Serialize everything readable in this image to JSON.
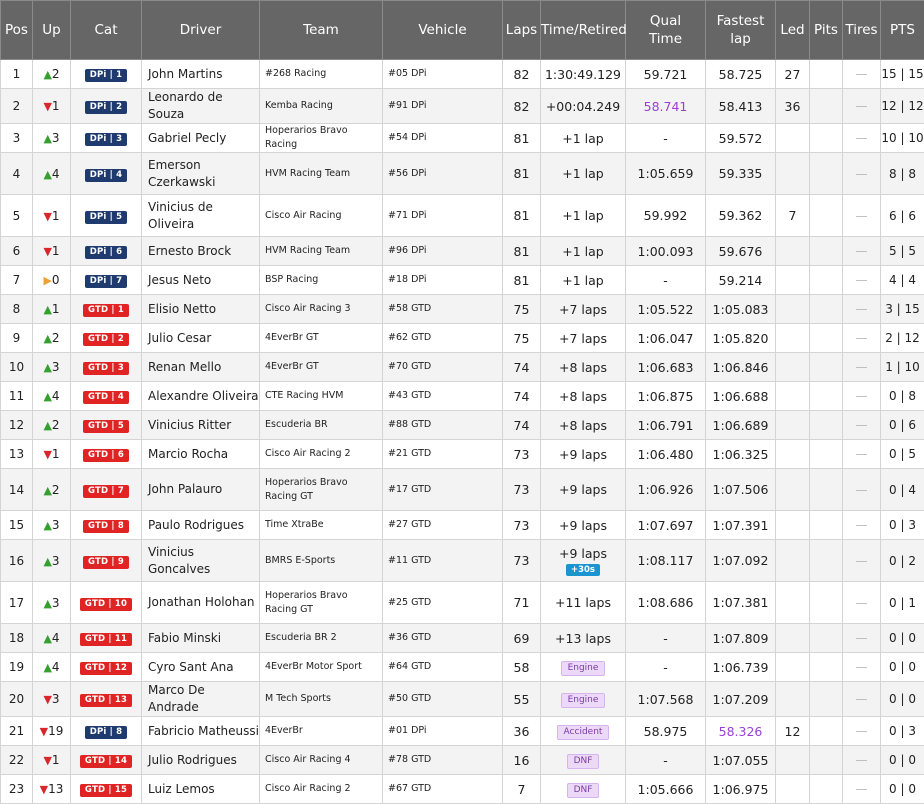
{
  "headers": {
    "pos": "Pos",
    "up": "Up",
    "cat": "Cat",
    "driver": "Driver",
    "team": "Team",
    "vehicle": "Vehicle",
    "laps": "Laps",
    "time": "Time/Retired",
    "qual": "Qual Time",
    "fastest": "Fastest lap",
    "led": "Led",
    "pits": "Pits",
    "tires": "Tires",
    "pts": "PTS"
  },
  "colors": {
    "header_bg": "#666666",
    "up": "#35a02f",
    "down": "#d9252c",
    "same": "#f0a030",
    "dpi": "#1e3a6e",
    "gtd": "#e02424",
    "purple": "#9b40d4",
    "penalty": "#1b95d2"
  },
  "rows": [
    {
      "pos": "1",
      "dir": "up",
      "up": "2",
      "cat": "DPi",
      "catpos": "DPi | 1",
      "driver": "John Martins",
      "team": "#268 Racing",
      "vehicle": "#05 DPi",
      "laps": "82",
      "time": "1:30:49.129",
      "qual": "59.721",
      "fastest": "58.725",
      "led": "27",
      "pits": "",
      "tires": "—",
      "pts": "15 | 15"
    },
    {
      "pos": "2",
      "dir": "down",
      "up": "1",
      "cat": "DPi",
      "catpos": "DPi | 2",
      "driver": "Leonardo de Souza",
      "team": "Kemba Racing",
      "vehicle": "#91 DPi",
      "laps": "82",
      "time": "+00:04.249",
      "qual": "58.741",
      "qual_best": true,
      "fastest": "58.413",
      "led": "36",
      "pits": "",
      "tires": "—",
      "pts": "12 | 12"
    },
    {
      "pos": "3",
      "dir": "up",
      "up": "3",
      "cat": "DPi",
      "catpos": "DPi | 3",
      "driver": "Gabriel Pecly",
      "team": "Hoperarios Bravo Racing",
      "vehicle": "#54 DPi",
      "laps": "81",
      "time": "+1 lap",
      "qual": "-",
      "fastest": "59.572",
      "led": "",
      "pits": "",
      "tires": "—",
      "pts": "10 | 10"
    },
    {
      "pos": "4",
      "dir": "up",
      "up": "4",
      "cat": "DPi",
      "catpos": "DPi | 4",
      "driver": "Emerson Czerkawski",
      "team": "HVM Racing Team",
      "vehicle": "#56 DPi",
      "laps": "81",
      "time": "+1 lap",
      "qual": "1:05.659",
      "fastest": "59.335",
      "led": "",
      "pits": "",
      "tires": "—",
      "pts": "8 | 8",
      "tall": true
    },
    {
      "pos": "5",
      "dir": "down",
      "up": "1",
      "cat": "DPi",
      "catpos": "DPi | 5",
      "driver": "Vinicius de Oliveira",
      "team": "Cisco Air Racing",
      "vehicle": "#71 DPi",
      "laps": "81",
      "time": "+1 lap",
      "qual": "59.992",
      "fastest": "59.362",
      "led": "7",
      "pits": "",
      "tires": "—",
      "pts": "6 | 6",
      "tall": true
    },
    {
      "pos": "6",
      "dir": "down",
      "up": "1",
      "cat": "DPi",
      "catpos": "DPi | 6",
      "driver": "Ernesto Brock",
      "team": "HVM Racing Team",
      "vehicle": "#96 DPi",
      "laps": "81",
      "time": "+1 lap",
      "qual": "1:00.093",
      "fastest": "59.676",
      "led": "",
      "pits": "",
      "tires": "—",
      "pts": "5 | 5"
    },
    {
      "pos": "7",
      "dir": "same",
      "up": "0",
      "cat": "DPi",
      "catpos": "DPi | 7",
      "driver": "Jesus Neto",
      "team": "BSP Racing",
      "vehicle": "#18 DPi",
      "laps": "81",
      "time": "+1 lap",
      "qual": "-",
      "fastest": "59.214",
      "led": "",
      "pits": "",
      "tires": "—",
      "pts": "4 | 4"
    },
    {
      "pos": "8",
      "dir": "up",
      "up": "1",
      "cat": "GTD",
      "catpos": "GTD | 1",
      "driver": "Elisio Netto",
      "team": "Cisco Air Racing 3",
      "vehicle": "#58 GTD",
      "laps": "75",
      "time": "+7 laps",
      "qual": "1:05.522",
      "fastest": "1:05.083",
      "led": "",
      "pits": "",
      "tires": "—",
      "pts": "3 | 15"
    },
    {
      "pos": "9",
      "dir": "up",
      "up": "2",
      "cat": "GTD",
      "catpos": "GTD | 2",
      "driver": "Julio Cesar",
      "team": "4EverBr GT",
      "vehicle": "#62 GTD",
      "laps": "75",
      "time": "+7 laps",
      "qual": "1:06.047",
      "fastest": "1:05.820",
      "led": "",
      "pits": "",
      "tires": "—",
      "pts": "2 | 12"
    },
    {
      "pos": "10",
      "dir": "up",
      "up": "3",
      "cat": "GTD",
      "catpos": "GTD | 3",
      "driver": "Renan Mello",
      "team": "4EverBr GT",
      "vehicle": "#70 GTD",
      "laps": "74",
      "time": "+8 laps",
      "qual": "1:06.683",
      "fastest": "1:06.846",
      "led": "",
      "pits": "",
      "tires": "—",
      "pts": "1 | 10"
    },
    {
      "pos": "11",
      "dir": "up",
      "up": "4",
      "cat": "GTD",
      "catpos": "GTD | 4",
      "driver": "Alexandre Oliveira",
      "team": "CTE Racing HVM",
      "vehicle": "#43 GTD",
      "laps": "74",
      "time": "+8 laps",
      "qual": "1:06.875",
      "fastest": "1:06.688",
      "led": "",
      "pits": "",
      "tires": "—",
      "pts": "0 | 8"
    },
    {
      "pos": "12",
      "dir": "up",
      "up": "2",
      "cat": "GTD",
      "catpos": "GTD | 5",
      "driver": "Vinicius Ritter",
      "team": "Escuderia BR",
      "vehicle": "#88 GTD",
      "laps": "74",
      "time": "+8 laps",
      "qual": "1:06.791",
      "fastest": "1:06.689",
      "led": "",
      "pits": "",
      "tires": "—",
      "pts": "0 | 6"
    },
    {
      "pos": "13",
      "dir": "down",
      "up": "1",
      "cat": "GTD",
      "catpos": "GTD | 6",
      "driver": "Marcio Rocha",
      "team": "Cisco Air Racing 2",
      "vehicle": "#21 GTD",
      "laps": "73",
      "time": "+9 laps",
      "qual": "1:06.480",
      "fastest": "1:06.325",
      "led": "",
      "pits": "",
      "tires": "—",
      "pts": "0 | 5"
    },
    {
      "pos": "14",
      "dir": "up",
      "up": "2",
      "cat": "GTD",
      "catpos": "GTD | 7",
      "driver": "John Palauro",
      "team": "Hoperarios Bravo Racing GT",
      "vehicle": "#17 GTD",
      "laps": "73",
      "time": "+9 laps",
      "qual": "1:06.926",
      "fastest": "1:07.506",
      "led": "",
      "pits": "",
      "tires": "—",
      "pts": "0 | 4",
      "tall": true
    },
    {
      "pos": "15",
      "dir": "up",
      "up": "3",
      "cat": "GTD",
      "catpos": "GTD | 8",
      "driver": "Paulo Rodrigues",
      "team": "Time XtraBe",
      "vehicle": "#27 GTD",
      "laps": "73",
      "time": "+9 laps",
      "qual": "1:07.697",
      "fastest": "1:07.391",
      "led": "",
      "pits": "",
      "tires": "—",
      "pts": "0 | 3"
    },
    {
      "pos": "16",
      "dir": "up",
      "up": "3",
      "cat": "GTD",
      "catpos": "GTD | 9",
      "driver": "Vinicius Goncalves",
      "team": "BMRS E-Sports",
      "vehicle": "#11 GTD",
      "laps": "73",
      "time": "+9 laps",
      "penalty": "+30s",
      "qual": "1:08.117",
      "fastest": "1:07.092",
      "led": "",
      "pits": "",
      "tires": "—",
      "pts": "0 | 2",
      "tall": true
    },
    {
      "pos": "17",
      "dir": "up",
      "up": "3",
      "cat": "GTD",
      "catpos": "GTD | 10",
      "driver": "Jonathan Holohan",
      "team": "Hoperarios Bravo Racing GT",
      "vehicle": "#25 GTD",
      "laps": "71",
      "time": "+11 laps",
      "qual": "1:08.686",
      "fastest": "1:07.381",
      "led": "",
      "pits": "",
      "tires": "—",
      "pts": "0 | 1",
      "tall": true
    },
    {
      "pos": "18",
      "dir": "up",
      "up": "4",
      "cat": "GTD",
      "catpos": "GTD | 11",
      "driver": "Fabio Minski",
      "team": "Escuderia BR 2",
      "vehicle": "#36 GTD",
      "laps": "69",
      "time": "+13 laps",
      "qual": "-",
      "fastest": "1:07.809",
      "led": "",
      "pits": "",
      "tires": "—",
      "pts": "0 | 0"
    },
    {
      "pos": "19",
      "dir": "up",
      "up": "4",
      "cat": "GTD",
      "catpos": "GTD | 12",
      "driver": "Cyro Sant Ana",
      "team": "4EverBr Motor Sport",
      "vehicle": "#64 GTD",
      "laps": "58",
      "pill": "Engine",
      "qual": "-",
      "fastest": "1:06.739",
      "led": "",
      "pits": "",
      "tires": "—",
      "pts": "0 | 0"
    },
    {
      "pos": "20",
      "dir": "down",
      "up": "3",
      "cat": "GTD",
      "catpos": "GTD | 13",
      "driver": "Marco De Andrade",
      "team": "M Tech Sports",
      "vehicle": "#50 GTD",
      "laps": "55",
      "pill": "Engine",
      "qual": "1:07.568",
      "fastest": "1:07.209",
      "led": "",
      "pits": "",
      "tires": "—",
      "pts": "0 | 0"
    },
    {
      "pos": "21",
      "dir": "down",
      "up": "19",
      "cat": "DPi",
      "catpos": "DPi | 8",
      "driver": "Fabricio Matheussi",
      "team": "4EverBr",
      "vehicle": "#01 DPi",
      "laps": "36",
      "pill": "Accident",
      "qual": "58.975",
      "fastest": "58.326",
      "fastest_best": true,
      "led": "12",
      "pits": "",
      "tires": "—",
      "pts": "0 | 3"
    },
    {
      "pos": "22",
      "dir": "down",
      "up": "1",
      "cat": "GTD",
      "catpos": "GTD | 14",
      "driver": "Julio Rodrigues",
      "team": "Cisco Air Racing 4",
      "vehicle": "#78 GTD",
      "laps": "16",
      "pill": "DNF",
      "qual": "-",
      "fastest": "1:07.055",
      "led": "",
      "pits": "",
      "tires": "—",
      "pts": "0 | 0"
    },
    {
      "pos": "23",
      "dir": "down",
      "up": "13",
      "cat": "GTD",
      "catpos": "GTD | 15",
      "driver": "Luiz Lemos",
      "team": "Cisco Air Racing 2",
      "vehicle": "#67 GTD",
      "laps": "7",
      "pill": "DNF",
      "qual": "1:05.666",
      "fastest": "1:06.975",
      "led": "",
      "pits": "",
      "tires": "—",
      "pts": "0 | 0"
    }
  ]
}
